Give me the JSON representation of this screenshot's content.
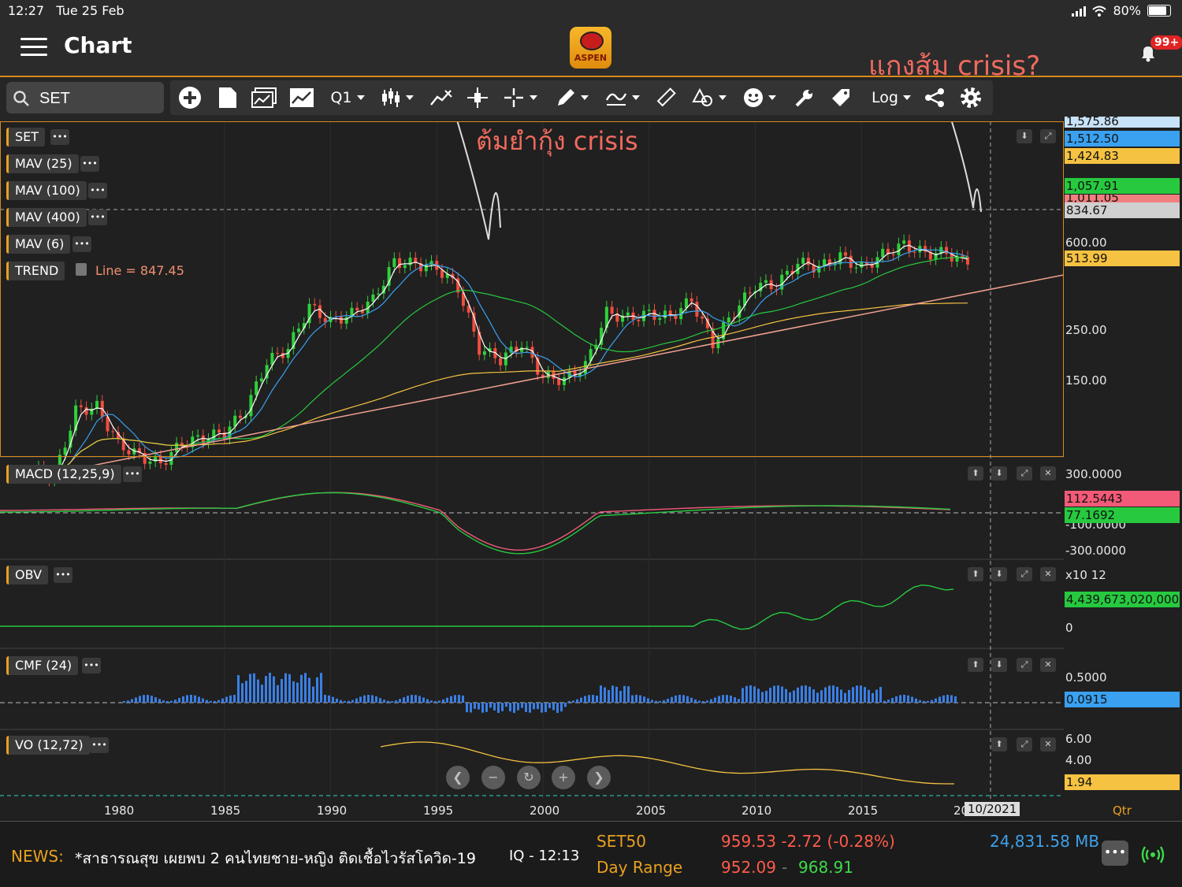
{
  "status_bar": {
    "time": "12:27",
    "date": "Tue 25 Feb",
    "battery": "80%"
  },
  "header": {
    "title": "Chart",
    "logo_text": "ASPEN",
    "annotation_orange": "แกงส้ม crisis?",
    "notification_badge": "99+"
  },
  "toolbar": {
    "search_value": "SET",
    "period": "Q1",
    "scale": "Log"
  },
  "main_panel": {
    "symbol_label": "SET",
    "indicators": [
      "MAV (25)",
      "MAV (100)",
      "MAV (400)",
      "MAV (6)"
    ],
    "trend_label": "TREND",
    "trend_line_value": "Line = 847.45",
    "annotation_white": "ต้มยำกุ้ง crisis",
    "y_labels": [
      "1,575.86",
      "600.00",
      "250.00",
      "150.00"
    ],
    "price_tags": [
      {
        "value": "1,512.50",
        "color": "#3aa0f0"
      },
      {
        "value": "1,424.83",
        "color": "#f5c242"
      },
      {
        "value": "1,057.91",
        "color": "#27c93f"
      },
      {
        "value": "1,011.05",
        "color": "#f07f7f"
      },
      {
        "value": "834.67",
        "color": "#d0d0d0"
      },
      {
        "value": "513.99",
        "color": "#f5c242"
      }
    ]
  },
  "macd_panel": {
    "label": "MACD (12,25,9)",
    "y_labels": [
      "300.0000",
      "-100.0000",
      "-300.0000"
    ],
    "price_tags": [
      {
        "value": "112.5443",
        "color": "#f25a78"
      },
      {
        "value": "77.1692",
        "color": "#27c93f"
      }
    ]
  },
  "obv_panel": {
    "label": "OBV",
    "y_labels": [
      "x10 12",
      "0"
    ],
    "price_tag": {
      "value": "4,439,673,020,000",
      "color": "#27c93f"
    }
  },
  "cmf_panel": {
    "label": "CMF (24)",
    "y_labels": [
      "0.5000"
    ],
    "price_tag": {
      "value": "0.0915",
      "color": "#3aa0f0"
    }
  },
  "vo_panel": {
    "label": "VO (12,72)",
    "y_labels": [
      "6.00",
      "4.00"
    ],
    "price_tag": {
      "value": "1.94",
      "color": "#f5c242"
    }
  },
  "x_axis": {
    "labels": [
      "1980",
      "1985",
      "1990",
      "1995",
      "2000",
      "2005",
      "2010",
      "2015",
      "20"
    ],
    "cursor_date": "10/2021",
    "interval": "Qtr"
  },
  "footer": {
    "news_label": "NEWS:",
    "news_text": "*สาธารณสุข เผยพบ 2 คนไทยชาย-หญิง ติดเชื้อไวรัสโควิด-19",
    "news_time": "IQ - 12:13",
    "index_name": "SET50",
    "index_value": "959.53 -2.72 (-0.28%)",
    "day_range_label": "Day Range",
    "day_low": "952.09",
    "range_sep": "-",
    "day_high": "968.91",
    "turnover": "24,831.58 MB"
  },
  "chart_data": {
    "type": "candlestick",
    "interval": "quarterly",
    "y_scale": "log",
    "x": [
      1976,
      1977,
      1978,
      1979,
      1980,
      1981,
      1982,
      1983,
      1984,
      1985,
      1986,
      1987,
      1988,
      1989,
      1990,
      1991,
      1992,
      1993,
      1994,
      1995,
      1996,
      1997,
      1998,
      1999,
      2000,
      2001,
      2002,
      2003,
      2004,
      2005,
      2006,
      2007,
      2008,
      2009,
      2010,
      2011,
      2012,
      2013,
      2014,
      2015,
      2016,
      2017,
      2018,
      2019,
      2020
    ],
    "series": [
      {
        "name": "SET",
        "values": [
          90,
          85,
          200,
          210,
          130,
          110,
          100,
          130,
          140,
          150,
          200,
          380,
          450,
          780,
          640,
          710,
          850,
          1400,
          1360,
          1300,
          1000,
          450,
          390,
          480,
          310,
          300,
          360,
          720,
          670,
          710,
          680,
          850,
          480,
          730,
          1030,
          1030,
          1390,
          1300,
          1500,
          1290,
          1540,
          1750,
          1560,
          1580,
          1350
        ]
      }
    ],
    "title": ""
  }
}
